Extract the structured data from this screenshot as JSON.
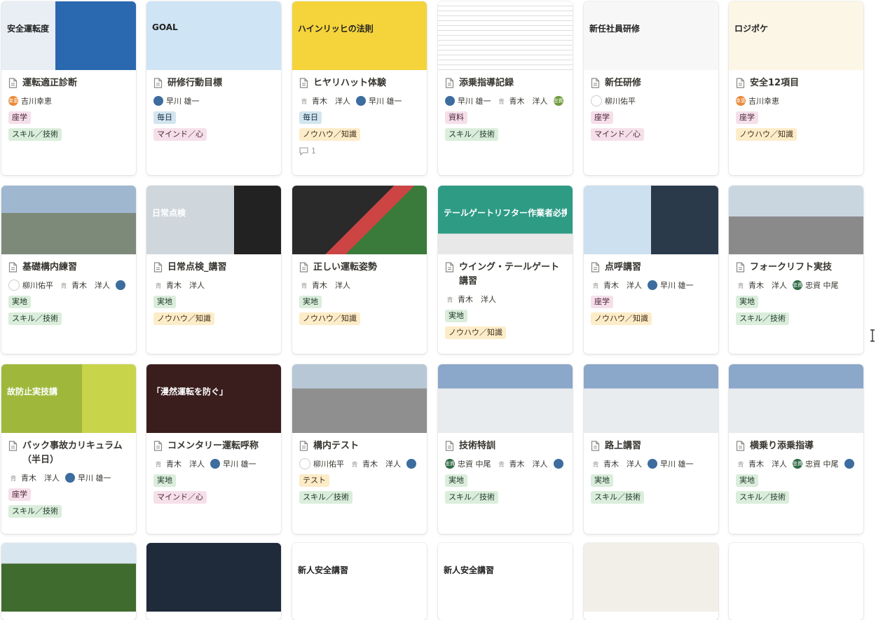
{
  "cards": [
    {
      "id": "c1",
      "title": "運転適正診断",
      "thumb_text": "安全運転度",
      "people": [
        {
          "name": "吉川幸恵",
          "av": "orange",
          "av_text": "幸恵"
        }
      ],
      "tags": [
        {
          "label": "座学",
          "color": "t-pink"
        },
        {
          "label": "スキル／技術",
          "color": "t-green"
        }
      ]
    },
    {
      "id": "c2",
      "title": "研修行動目標",
      "thumb_text": "GOAL",
      "people": [
        {
          "name": "早川 雄一",
          "av": "blue",
          "av_text": ""
        }
      ],
      "tags": [
        {
          "label": "毎日",
          "color": "t-blue"
        },
        {
          "label": "マインド／心",
          "color": "t-pink"
        }
      ]
    },
    {
      "id": "c3",
      "title": "ヒヤリハット体験",
      "thumb_text": "ハインリッヒの法則",
      "people": [
        {
          "name": "青木　洋人",
          "av": "gray",
          "av_text": "青"
        },
        {
          "name": "早川 雄一",
          "av": "blue",
          "av_text": ""
        }
      ],
      "tags": [
        {
          "label": "毎日",
          "color": "t-blue"
        },
        {
          "label": "ノウハウ／知識",
          "color": "t-yellow2"
        }
      ],
      "comments": "1"
    },
    {
      "id": "c4",
      "title": "添乗指導記録",
      "thumb_text": "",
      "people": [
        {
          "name": "早川 雄一",
          "av": "blue",
          "av_text": ""
        },
        {
          "name": "青木　洋人",
          "av": "gray",
          "av_text": "青"
        },
        {
          "name": "",
          "av": "olive",
          "av_text": "忠資"
        }
      ],
      "tags": [
        {
          "label": "資料",
          "color": "t-pink"
        },
        {
          "label": "スキル／技術",
          "color": "t-green"
        }
      ]
    },
    {
      "id": "c5",
      "title": "新任研修",
      "thumb_text": "新任社員研修",
      "people": [
        {
          "name": "柳川佑平",
          "av": "face",
          "av_text": ""
        }
      ],
      "tags": [
        {
          "label": "座学",
          "color": "t-pink"
        },
        {
          "label": "マインド／心",
          "color": "t-pink"
        }
      ]
    },
    {
      "id": "c6",
      "title": "安全12項目",
      "thumb_text": "ロジポケ",
      "people": [
        {
          "name": "吉川幸恵",
          "av": "orange",
          "av_text": "幸恵"
        }
      ],
      "tags": [
        {
          "label": "座学",
          "color": "t-pink"
        },
        {
          "label": "ノウハウ／知識",
          "color": "t-yellow2"
        }
      ]
    },
    {
      "id": "c7",
      "title": "基礎構内練習",
      "thumb_text": "",
      "people": [
        {
          "name": "柳川佑平",
          "av": "face",
          "av_text": ""
        },
        {
          "name": "青木　洋人",
          "av": "gray",
          "av_text": "青"
        },
        {
          "name": "",
          "av": "blue",
          "av_text": ""
        }
      ],
      "tags": [
        {
          "label": "実地",
          "color": "t-green"
        },
        {
          "label": "スキル／技術",
          "color": "t-green"
        }
      ]
    },
    {
      "id": "c8",
      "title": "日常点検_講習",
      "thumb_text": "日常点検",
      "people": [
        {
          "name": "青木　洋人",
          "av": "gray",
          "av_text": "青"
        }
      ],
      "tags": [
        {
          "label": "実地",
          "color": "t-green"
        },
        {
          "label": "ノウハウ／知識",
          "color": "t-yellow2"
        }
      ]
    },
    {
      "id": "c9",
      "title": "正しい運転姿勢",
      "thumb_text": "",
      "people": [
        {
          "name": "青木　洋人",
          "av": "gray",
          "av_text": "青"
        }
      ],
      "tags": [
        {
          "label": "実地",
          "color": "t-green"
        },
        {
          "label": "ノウハウ／知識",
          "color": "t-yellow2"
        }
      ]
    },
    {
      "id": "c10",
      "title": "ウイング・テールゲート講習",
      "thumb_text": "テールゲートリフター作業者必携",
      "people": [
        {
          "name": "青木　洋人",
          "av": "gray",
          "av_text": "青"
        }
      ],
      "tags": [
        {
          "label": "実地",
          "color": "t-green"
        },
        {
          "label": "ノウハウ／知識",
          "color": "t-yellow2"
        }
      ]
    },
    {
      "id": "c11",
      "title": "点呼講習",
      "thumb_text": "",
      "people": [
        {
          "name": "青木　洋人",
          "av": "gray",
          "av_text": "青"
        },
        {
          "name": "早川 雄一",
          "av": "blue",
          "av_text": ""
        }
      ],
      "tags": [
        {
          "label": "座学",
          "color": "t-pink"
        },
        {
          "label": "ノウハウ／知識",
          "color": "t-yellow2"
        }
      ]
    },
    {
      "id": "c12",
      "title": "フォークリフト実技",
      "thumb_text": "",
      "people": [
        {
          "name": "青木　洋人",
          "av": "gray",
          "av_text": "青"
        },
        {
          "name": "忠資 中尾",
          "av": "green",
          "av_text": "忠資"
        }
      ],
      "tags": [
        {
          "label": "実地",
          "color": "t-green"
        },
        {
          "label": "スキル／技術",
          "color": "t-green"
        }
      ]
    },
    {
      "id": "c13",
      "title": "バック事故カリキュラム（半日）",
      "thumb_text": "故防止実技講",
      "people": [
        {
          "name": "青木　洋人",
          "av": "gray",
          "av_text": "青"
        },
        {
          "name": "早川 雄一",
          "av": "blue",
          "av_text": ""
        }
      ],
      "tags": [
        {
          "label": "座学",
          "color": "t-pink"
        },
        {
          "label": "スキル／技術",
          "color": "t-green"
        }
      ]
    },
    {
      "id": "c14",
      "title": "コメンタリー運転呼称",
      "thumb_text": "「漫然運転を防ぐ」",
      "people": [
        {
          "name": "青木　洋人",
          "av": "gray",
          "av_text": "青"
        },
        {
          "name": "早川 雄一",
          "av": "blue",
          "av_text": ""
        }
      ],
      "tags": [
        {
          "label": "実地",
          "color": "t-green"
        },
        {
          "label": "マインド／心",
          "color": "t-pink"
        }
      ]
    },
    {
      "id": "c15",
      "title": "構内テスト",
      "thumb_text": "",
      "people": [
        {
          "name": "柳川佑平",
          "av": "face",
          "av_text": ""
        },
        {
          "name": "青木　洋人",
          "av": "gray",
          "av_text": "青"
        },
        {
          "name": "",
          "av": "blue",
          "av_text": ""
        }
      ],
      "tags": [
        {
          "label": "テスト",
          "color": "t-yellow2"
        },
        {
          "label": "スキル／技術",
          "color": "t-green"
        }
      ]
    },
    {
      "id": "c16",
      "title": "技術特訓",
      "thumb_text": "",
      "people": [
        {
          "name": "忠資 中尾",
          "av": "green",
          "av_text": "忠資"
        },
        {
          "name": "青木　洋人",
          "av": "gray",
          "av_text": "青"
        },
        {
          "name": "",
          "av": "blue",
          "av_text": ""
        }
      ],
      "tags": [
        {
          "label": "実地",
          "color": "t-green"
        },
        {
          "label": "スキル／技術",
          "color": "t-green"
        }
      ]
    },
    {
      "id": "c17",
      "title": "路上講習",
      "thumb_text": "",
      "people": [
        {
          "name": "青木　洋人",
          "av": "gray",
          "av_text": "青"
        },
        {
          "name": "早川 雄一",
          "av": "blue",
          "av_text": ""
        }
      ],
      "tags": [
        {
          "label": "実地",
          "color": "t-green"
        },
        {
          "label": "スキル／技術",
          "color": "t-green"
        }
      ]
    },
    {
      "id": "c18",
      "title": "横乗り添乗指導",
      "thumb_text": "",
      "people": [
        {
          "name": "青木　洋人",
          "av": "gray",
          "av_text": "青"
        },
        {
          "name": "忠資 中尾",
          "av": "green",
          "av_text": "忠資"
        },
        {
          "name": "",
          "av": "blue",
          "av_text": ""
        }
      ],
      "tags": [
        {
          "label": "実地",
          "color": "t-green"
        },
        {
          "label": "スキル／技術",
          "color": "t-green"
        }
      ]
    },
    {
      "id": "c19",
      "title": "",
      "thumb_text": "",
      "people": [],
      "tags": []
    },
    {
      "id": "c20",
      "title": "",
      "thumb_text": "",
      "people": [],
      "tags": []
    },
    {
      "id": "c21",
      "title": "",
      "thumb_text": "新人安全講習",
      "people": [],
      "tags": []
    },
    {
      "id": "c22",
      "title": "",
      "thumb_text": "新人安全講習",
      "people": [],
      "tags": []
    },
    {
      "id": "c23",
      "title": "",
      "thumb_text": "",
      "people": [],
      "tags": []
    },
    {
      "id": "c24",
      "title": "",
      "thumb_text": "",
      "people": [],
      "tags": []
    }
  ]
}
